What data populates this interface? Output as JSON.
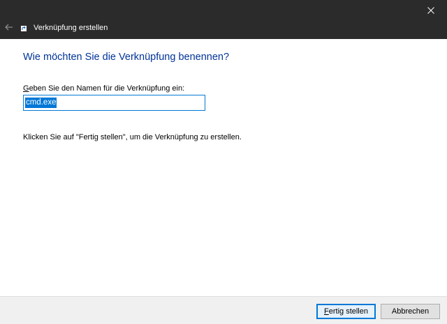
{
  "window": {
    "title": "Verknüpfung erstellen",
    "icons": {
      "close": "close-icon",
      "back": "back-arrow-icon",
      "app": "shortcut-icon"
    },
    "colors": {
      "titlebar": "#2b2b2b",
      "heading": "#003399",
      "accent": "#0078d7",
      "footer": "#f0f0f0"
    }
  },
  "main": {
    "heading": "Wie möchten Sie die Verknüpfung benennen?",
    "field_label_access_key": "G",
    "field_label_rest": "eben Sie den Namen für die Verknüpfung ein:",
    "name_value": "cmd.exe",
    "instruction": "Klicken Sie auf \"Fertig stellen\", um die Verknüpfung zu erstellen."
  },
  "footer": {
    "finish_access_key": "F",
    "finish_rest": "ertig stellen",
    "cancel_label": "Abbrechen"
  }
}
